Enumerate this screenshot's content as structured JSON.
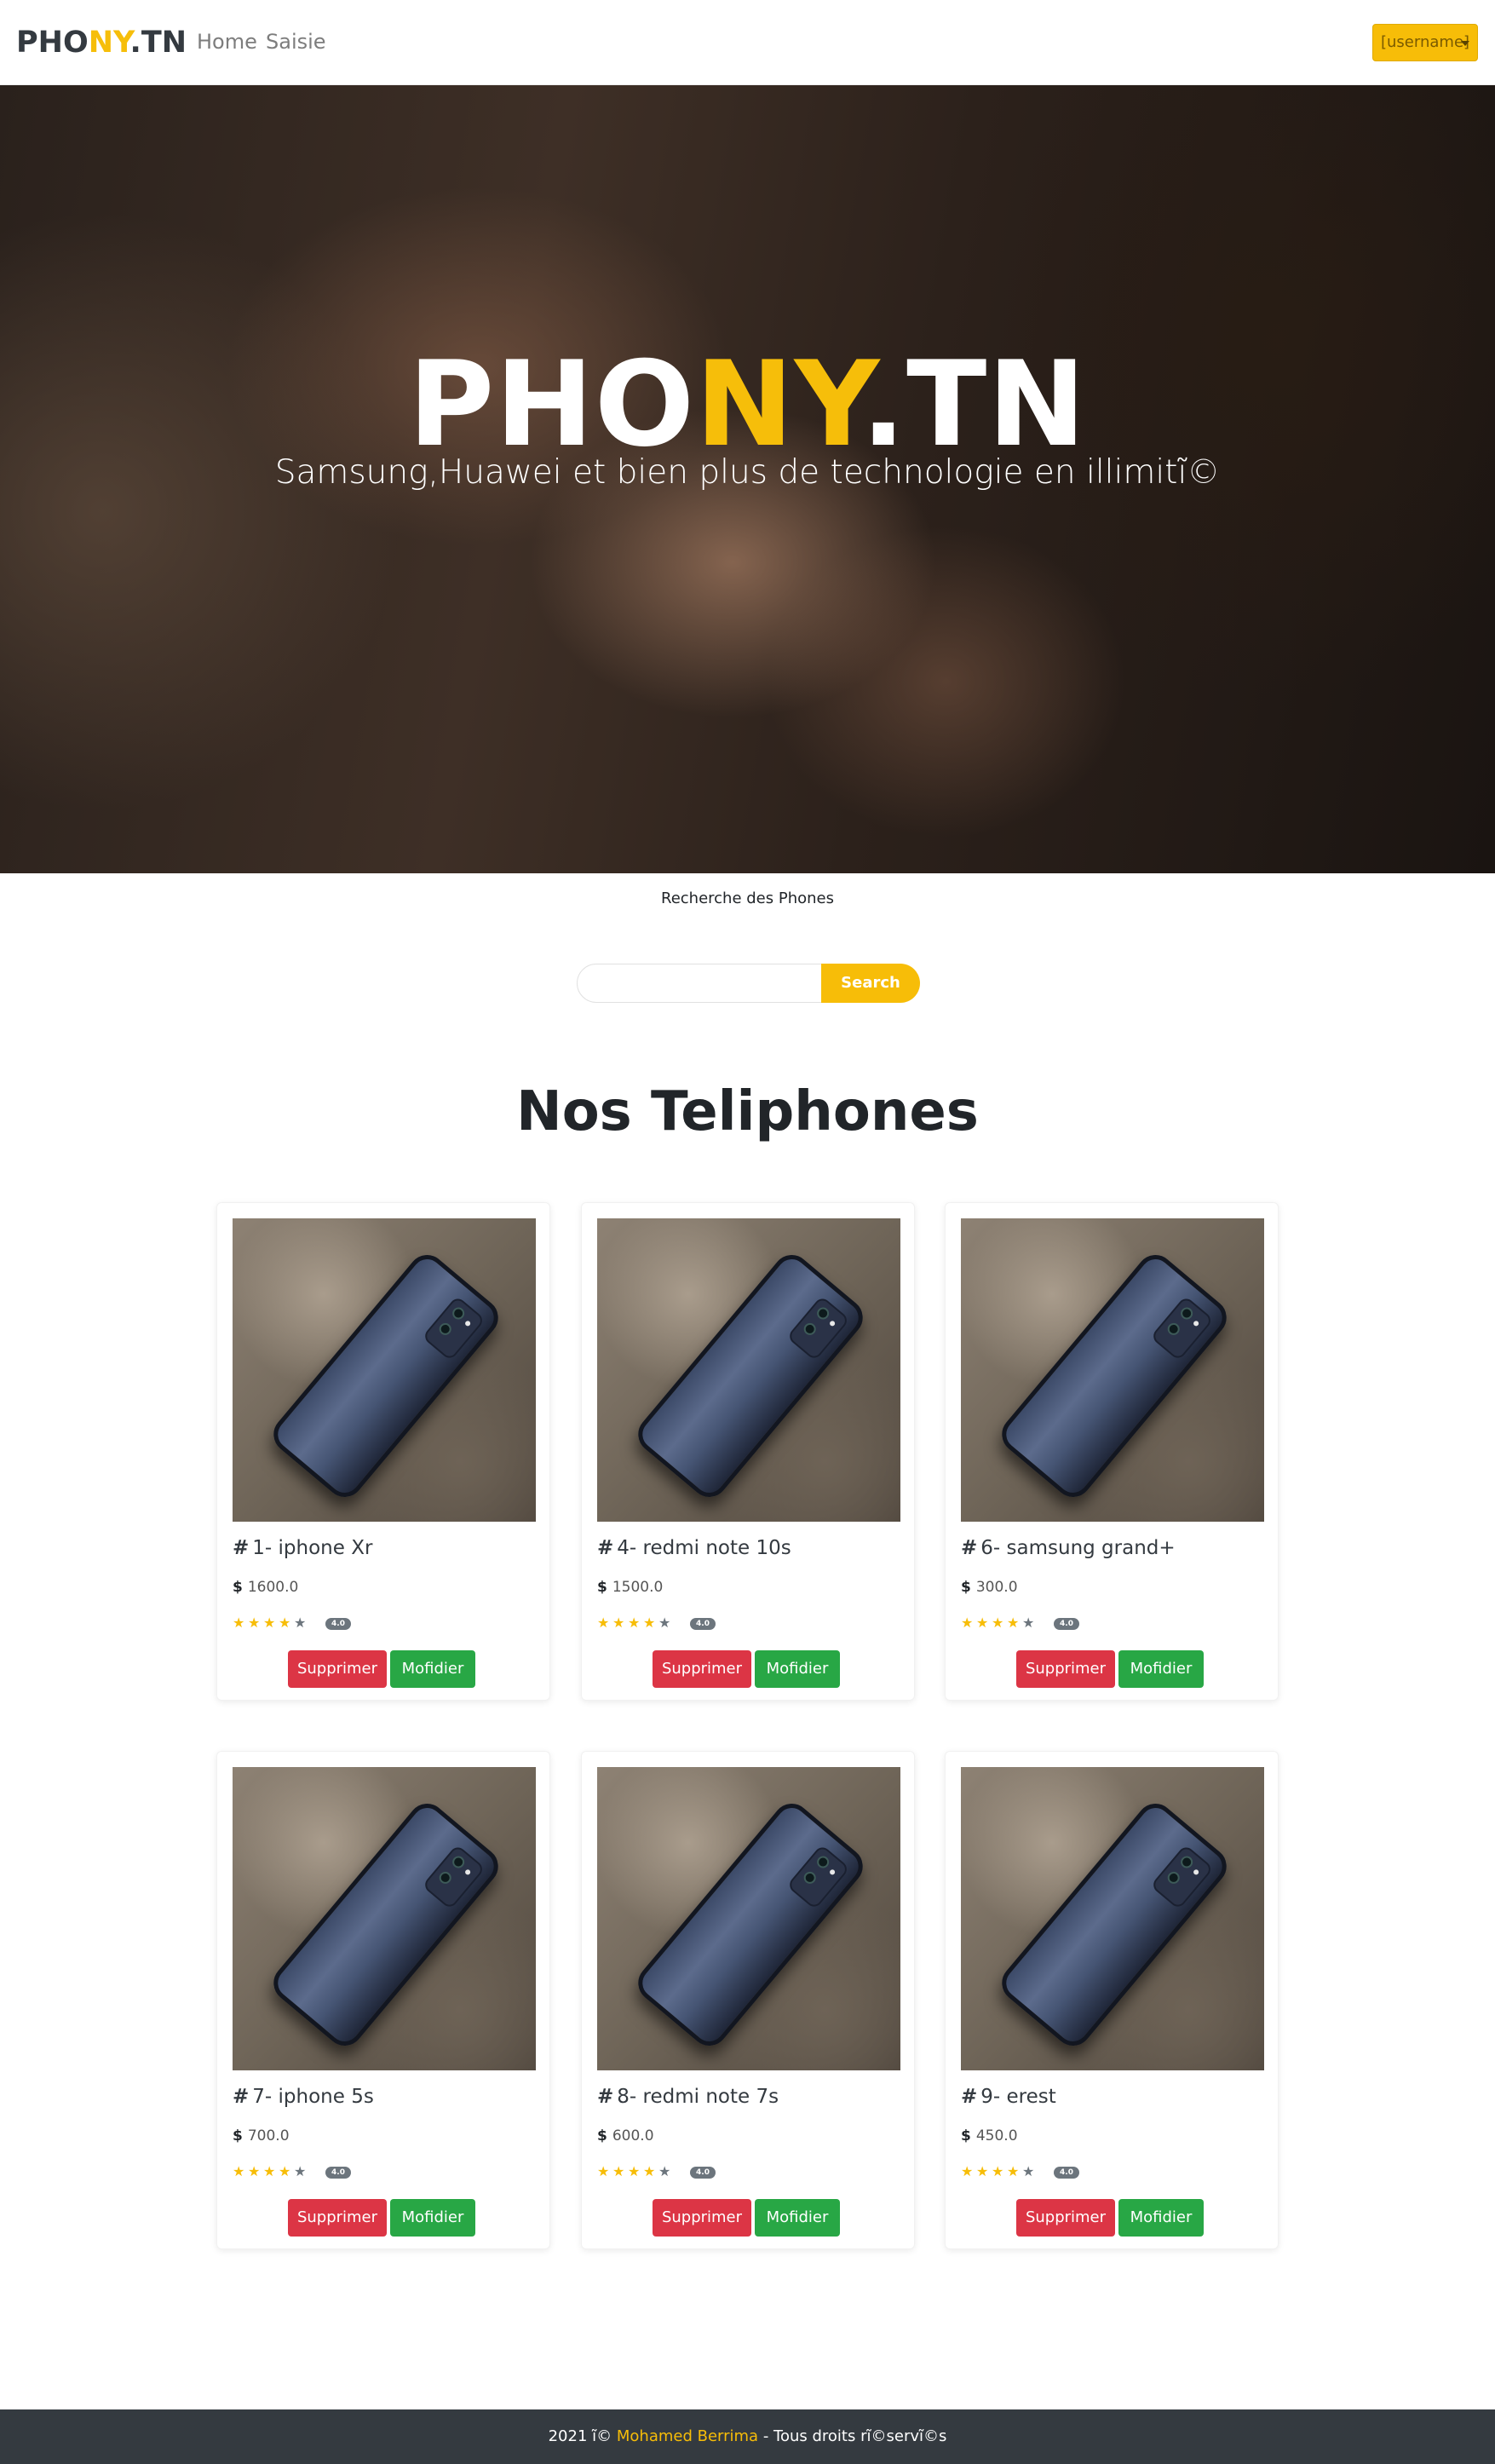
{
  "navbar": {
    "brand_part1": "PHO",
    "brand_part2": "NY",
    "brand_part3": ".TN",
    "links": [
      "Home",
      "Saisie"
    ],
    "user_button": "[username]"
  },
  "hero": {
    "title_part1": "PHO",
    "title_part2": "NY",
    "title_part3": ".TN",
    "subtitle": "Samsung,Huawei et bien plus de technologie en illimitĩ©"
  },
  "search": {
    "label": "Recherche des Phones",
    "placeholder": "",
    "button": "Search"
  },
  "section_title": "Nos Teliphones",
  "products": [
    {
      "title": "1- iphone Xr",
      "price": "1600.0",
      "rating": 4,
      "rating_label": "4.0",
      "delete_label": "Supprimer",
      "edit_label": "Mofidier"
    },
    {
      "title": "4- redmi note 10s",
      "price": "1500.0",
      "rating": 4,
      "rating_label": "4.0",
      "delete_label": "Supprimer",
      "edit_label": "Mofidier"
    },
    {
      "title": "6- samsung grand+",
      "price": "300.0",
      "rating": 4,
      "rating_label": "4.0",
      "delete_label": "Supprimer",
      "edit_label": "Mofidier"
    },
    {
      "title": "7- iphone 5s",
      "price": "700.0",
      "rating": 4,
      "rating_label": "4.0",
      "delete_label": "Supprimer",
      "edit_label": "Mofidier"
    },
    {
      "title": "8- redmi note 7s",
      "price": "600.0",
      "rating": 4,
      "rating_label": "4.0",
      "delete_label": "Supprimer",
      "edit_label": "Mofidier"
    },
    {
      "title": "9- erest",
      "price": "450.0",
      "rating": 4,
      "rating_label": "4.0",
      "delete_label": "Supprimer",
      "edit_label": "Mofidier"
    }
  ],
  "footer": {
    "prefix": "2021 ĩ© ",
    "author": "Mohamed Berrima",
    "suffix": " - Tous droits rĩ©servĩ©s"
  },
  "colors": {
    "accent": "#f7bd08",
    "danger": "#dc3545",
    "success": "#28a745",
    "dark": "#343a40"
  }
}
